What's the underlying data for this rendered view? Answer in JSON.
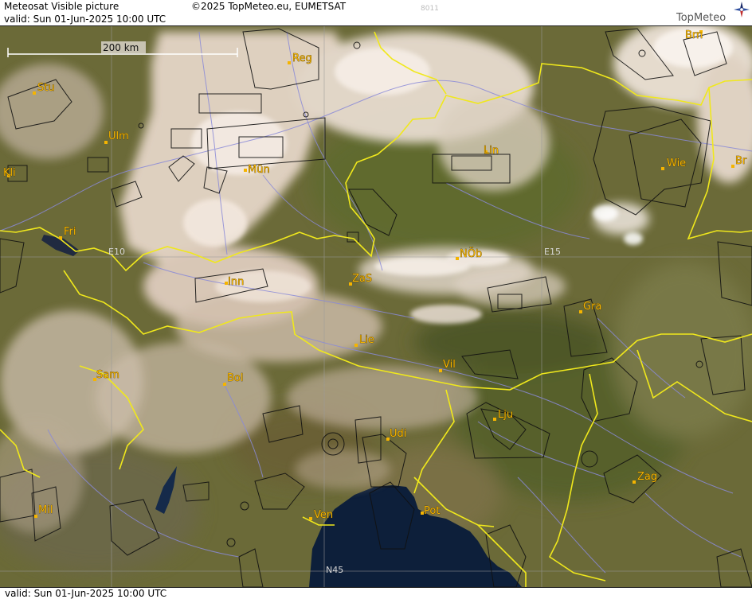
{
  "header": {
    "product": "Meteosat Visible picture",
    "copyright": "©2025 TopMeteo.eu, EUMETSAT",
    "code": "8011",
    "valid": "valid:  Sun  01-Jun-2025  10:00 UTC",
    "logo_text": "TopMeteo"
  },
  "footer": {
    "valid": "valid:  Sun  01-Jun-2025  10:00 UTC"
  },
  "map": {
    "scale_label": "200 km",
    "grid_labels": {
      "e10": "E10",
      "e15": "E15",
      "n45": "N45"
    },
    "cities": [
      {
        "label": "Reg"
      },
      {
        "label": "Brn"
      },
      {
        "label": "Stu"
      },
      {
        "label": "Ulm"
      },
      {
        "label": "Mün"
      },
      {
        "label": "Lin"
      },
      {
        "label": "Wie"
      },
      {
        "label": "Br"
      },
      {
        "label": "Kli"
      },
      {
        "label": "Fri"
      },
      {
        "label": "Inn"
      },
      {
        "label": "ZaS"
      },
      {
        "label": "NÖb"
      },
      {
        "label": "Gra"
      },
      {
        "label": "Lie"
      },
      {
        "label": "Vil"
      },
      {
        "label": "Sam"
      },
      {
        "label": "Bol"
      },
      {
        "label": "Lju"
      },
      {
        "label": "Udi"
      },
      {
        "label": "Zag"
      },
      {
        "label": "Mil"
      },
      {
        "label": "Ven"
      },
      {
        "label": "Pot"
      }
    ],
    "colors": {
      "land": "#6b6a38",
      "sea": "#0d1f3a",
      "cloud": "#efe2d6",
      "border": "#f0e81c",
      "river": "#8a8ad8",
      "airspace": "#111111",
      "city": "#f5b400"
    }
  }
}
